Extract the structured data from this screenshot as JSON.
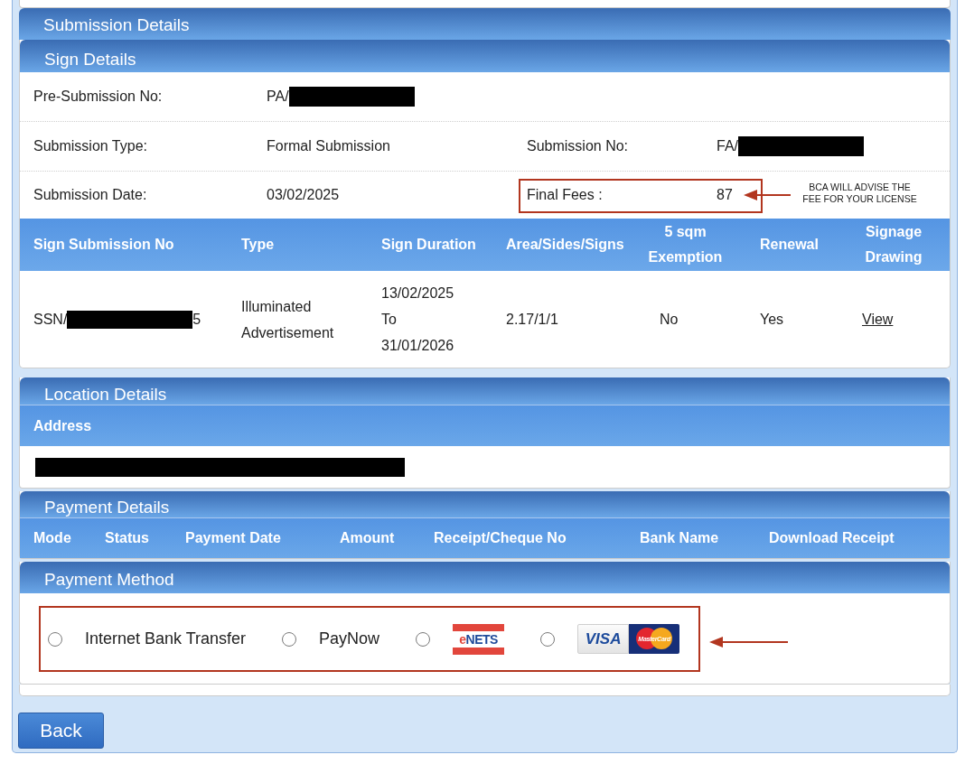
{
  "submission_details": {
    "title": "Submission Details"
  },
  "sign_details": {
    "title": "Sign Details",
    "fields": [
      [
        {
          "label": "Pre-Submission No:",
          "value": "PA/",
          "redacted": true,
          "highlighted": false
        }
      ],
      [
        {
          "label": "Submission Type:",
          "value": "Formal Submission",
          "redacted": false,
          "highlighted": false
        },
        {
          "label": "Submission No:",
          "value": "FA/",
          "redacted": true,
          "highlighted": false
        }
      ],
      [
        {
          "label": "Submission Date:",
          "value": "03/02/2025",
          "redacted": false,
          "highlighted": false
        },
        {
          "label": "Final Fees :",
          "value": "87",
          "redacted": false,
          "highlighted": true,
          "note": "BCA WILL ADVISE THE FEE FOR YOUR LICENSE"
        }
      ]
    ],
    "table": {
      "columns": [
        "Sign Submission No",
        "Type",
        "Sign Duration",
        "Area/Sides/Signs",
        "5 sqm Exemption",
        "Renewal",
        "Signage Drawing"
      ],
      "rows": [
        [
          {
            "kind": "redacted",
            "text": "SSN/",
            "suffix": "5"
          },
          {
            "kind": "text",
            "text": "Illuminated Advertisement"
          },
          {
            "kind": "text",
            "text": "13/02/2025 To 31/01/2026"
          },
          {
            "kind": "text",
            "text": "2.17/1/1"
          },
          {
            "kind": "text",
            "text": "No"
          },
          {
            "kind": "text",
            "text": "Yes"
          },
          {
            "kind": "link",
            "text": "View"
          }
        ]
      ]
    }
  },
  "location_details": {
    "title": "Location Details",
    "columns": [
      "Address"
    ],
    "rows": [
      [
        {
          "kind": "redacted"
        }
      ]
    ]
  },
  "payment_details": {
    "title": "Payment Details",
    "columns": [
      "Mode",
      "Status",
      "Payment Date",
      "Amount",
      "Receipt/Cheque No",
      "Bank Name",
      "Download Receipt"
    ]
  },
  "payment_method": {
    "title": "Payment Method",
    "highlighted": true,
    "options": [
      {
        "kind": "text",
        "label": "Internet Bank Transfer",
        "selected": false
      },
      {
        "kind": "text",
        "label": "PayNow",
        "selected": false
      },
      {
        "kind": "enets",
        "logo_text": "eNETS",
        "selected": false
      },
      {
        "kind": "cards",
        "logos": [
          {
            "kind": "visa",
            "text": "VISA"
          },
          {
            "kind": "mastercard",
            "text": "MasterCard"
          }
        ],
        "selected": false
      }
    ]
  },
  "back_button": {
    "label": "Back"
  }
}
